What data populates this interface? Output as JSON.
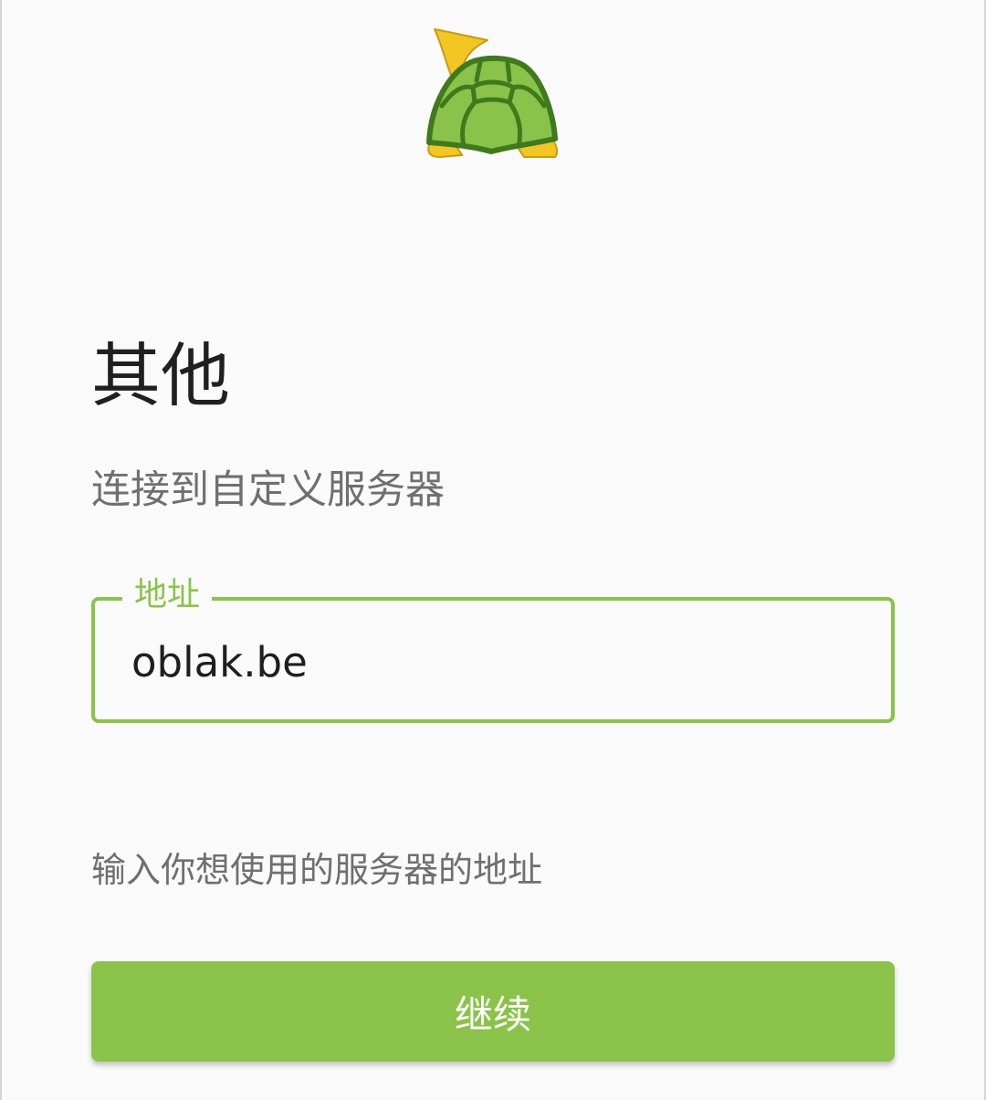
{
  "header": {
    "logo_icon": "turtle-logo-icon"
  },
  "page": {
    "title": "其他",
    "subtitle": "连接到自定义服务器"
  },
  "address_field": {
    "label": "地址",
    "value": "oblak.be",
    "hint": "输入你想使用的服务器的地址"
  },
  "actions": {
    "continue_label": "继续"
  },
  "colors": {
    "accent": "#8bc34a",
    "background": "#fafafa"
  }
}
